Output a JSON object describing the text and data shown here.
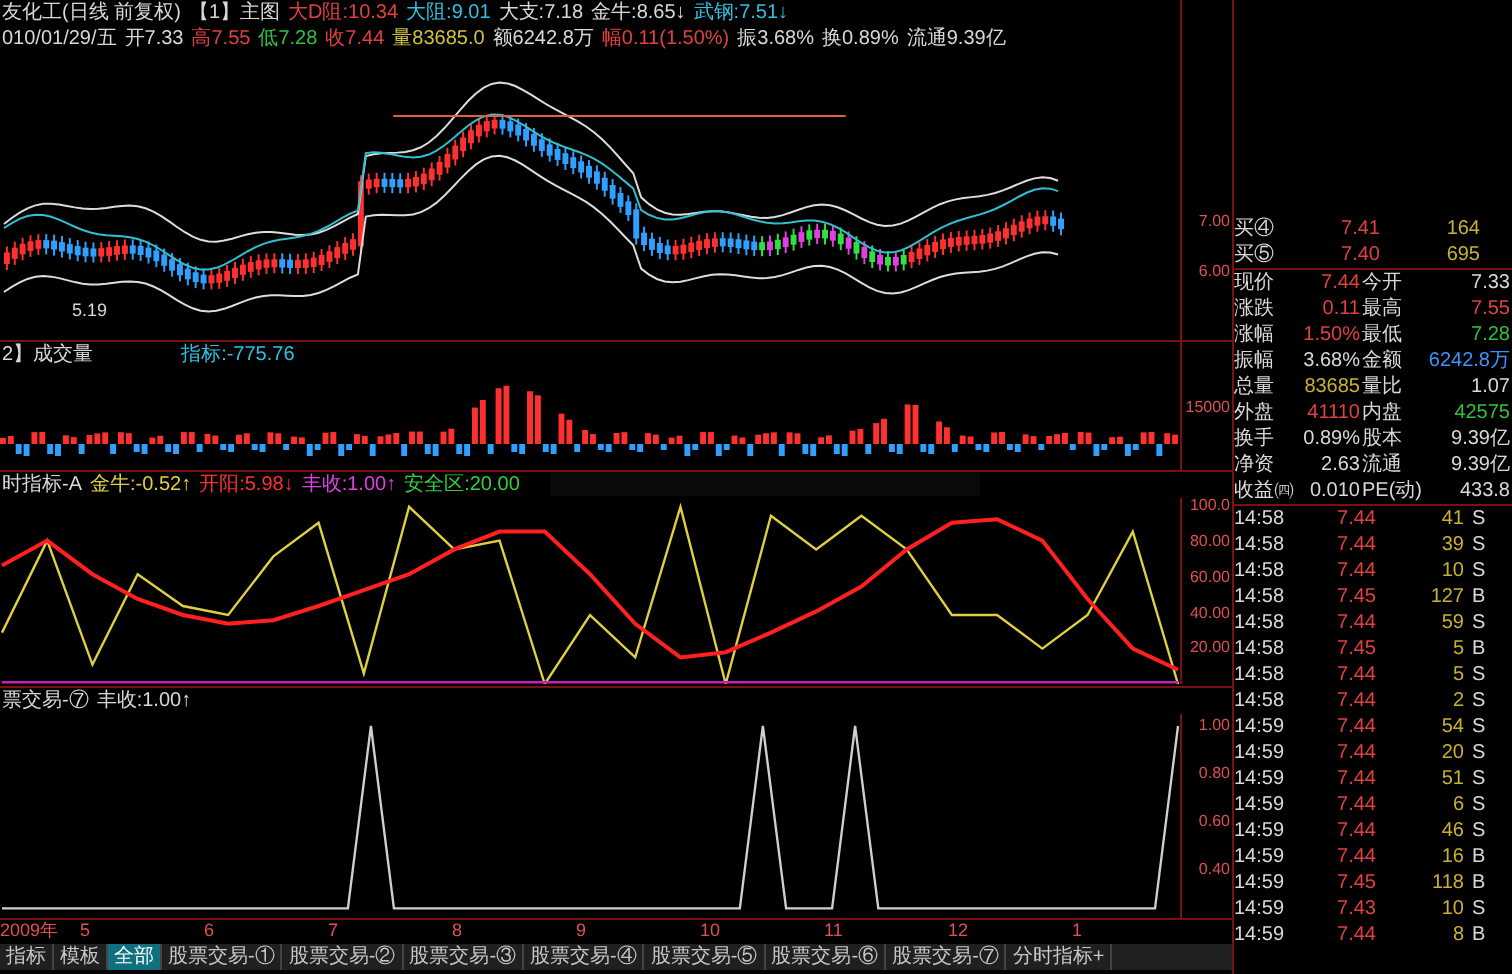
{
  "header": {
    "line1": [
      {
        "text": "友化工(日线 前复权)",
        "color": "#d8d8d8"
      },
      {
        "text": "【1】主图",
        "color": "#d8d8d8"
      },
      {
        "text": "大D阻:10.34",
        "color": "#e04040"
      },
      {
        "text": "大阻:9.01",
        "color": "#30c0e0"
      },
      {
        "text": "大支:7.18",
        "color": "#d8d8d8"
      },
      {
        "text": "金牛:8.65↓",
        "color": "#d8d8d8"
      },
      {
        "text": "武钢:7.51↓",
        "color": "#30c0e0"
      }
    ],
    "line2": [
      {
        "text": "010/01/29/五",
        "color": "#d8d8d8"
      },
      {
        "text": "开7.33",
        "color": "#d8d8d8"
      },
      {
        "text": "高7.55",
        "color": "#e04040"
      },
      {
        "text": "低7.28",
        "color": "#30c040"
      },
      {
        "text": "收7.44",
        "color": "#e04040"
      },
      {
        "text": "量83685.0",
        "color": "#d0c040"
      },
      {
        "text": "额6242.8万",
        "color": "#d8d8d8"
      },
      {
        "text": "幅0.11(1.50%)",
        "color": "#e04040"
      },
      {
        "text": "振3.68%",
        "color": "#d8d8d8"
      },
      {
        "text": "换0.89%",
        "color": "#d8d8d8"
      },
      {
        "text": "流通9.39亿",
        "color": "#d8d8d8"
      }
    ]
  },
  "price_chart": {
    "low_marker": "5.19",
    "axis": [
      "7.00",
      "6.00"
    ]
  },
  "volume_panel": {
    "title": "2】成交量",
    "indicator": "指标:-775.76",
    "axis": [
      "15000"
    ]
  },
  "indicator_panel": {
    "items": [
      {
        "text": "时指标-A",
        "color": "#d8d8d8"
      },
      {
        "text": "金牛:-0.52↑",
        "color": "#e0d040"
      },
      {
        "text": "开阳:5.98↓",
        "color": "#ff3030"
      },
      {
        "text": "丰收:1.00↑",
        "color": "#e040e0"
      },
      {
        "text": "安全区:20.00",
        "color": "#30d040"
      }
    ],
    "chart_data": {
      "type": "line",
      "ylim": [
        0,
        105
      ],
      "yticks": [
        {
          "value": 100,
          "label": "100.0"
        },
        {
          "value": 80,
          "label": "80.00"
        },
        {
          "value": 60,
          "label": "60.00"
        },
        {
          "value": 40,
          "label": "40.00"
        },
        {
          "value": 20,
          "label": "20.00"
        }
      ],
      "series": [
        {
          "color": "#e0d040",
          "values": [
            29,
            81,
            11,
            62,
            44,
            39,
            72,
            91,
            6,
            100,
            76,
            81,
            0,
            39,
            15,
            100,
            0,
            95,
            76,
            95,
            76,
            39,
            39,
            20,
            39,
            86,
            0
          ]
        },
        {
          "color": "#ff2020",
          "values": [
            67,
            81,
            62,
            48,
            39,
            34,
            36,
            44,
            53,
            62,
            76,
            86,
            86,
            62,
            34,
            15,
            18,
            29,
            41,
            55,
            76,
            91,
            93,
            81,
            48,
            20,
            8
          ]
        },
        {
          "color": "#c020c0",
          "values": [
            1,
            1,
            1,
            1,
            1,
            1,
            1,
            1,
            1,
            1,
            1,
            1,
            1,
            1,
            1,
            1,
            1,
            1,
            1,
            1,
            1,
            1,
            1,
            1,
            1,
            1,
            1
          ]
        }
      ]
    }
  },
  "lower_panel": {
    "items": [
      {
        "text": "票交易-⑦",
        "color": "#d8d8d8"
      },
      {
        "text": "丰收:1.00↑",
        "color": "#d8d8d8"
      }
    ],
    "chart_data": {
      "type": "line",
      "ylim": [
        0.2,
        1.05
      ],
      "yticks": [
        {
          "value": 1,
          "label": "1.00"
        },
        {
          "value": 0.8,
          "label": "0.80"
        },
        {
          "value": 0.6,
          "label": "0.60"
        },
        {
          "value": 0.4,
          "label": "0.40"
        }
      ],
      "series": [
        {
          "color": "#d0d0d0",
          "values": [
            0.24,
            0.24,
            0.24,
            0.24,
            0.24,
            0.24,
            0.24,
            0.24,
            0.24,
            0.24,
            0.24,
            0.24,
            0.24,
            0.24,
            0.24,
            0.24,
            1,
            0.24,
            0.24,
            0.24,
            0.24,
            0.24,
            0.24,
            0.24,
            0.24,
            0.24,
            0.24,
            0.24,
            0.24,
            0.24,
            0.24,
            0.24,
            0.24,
            1,
            0.24,
            0.24,
            0.24,
            1,
            0.24,
            0.24,
            0.24,
            0.24,
            0.24,
            0.24,
            0.24,
            0.24,
            0.24,
            0.24,
            0.24,
            0.24,
            0.24,
            1
          ]
        }
      ]
    }
  },
  "x_axis": [
    "2009年",
    "5",
    "6",
    "7",
    "8",
    "9",
    "10",
    "11",
    "12",
    "1"
  ],
  "bottom_tabs": [
    {
      "label": "指标",
      "selected": false
    },
    {
      "label": "模板",
      "selected": false
    },
    {
      "label": "全部",
      "selected": true
    },
    {
      "label": "股票交易-①",
      "selected": false
    },
    {
      "label": "股票交易-②",
      "selected": false
    },
    {
      "label": "股票交易-③",
      "selected": false
    },
    {
      "label": "股票交易-④",
      "selected": false
    },
    {
      "label": "股票交易-⑤",
      "selected": false
    },
    {
      "label": "股票交易-⑥",
      "selected": false
    },
    {
      "label": "股票交易-⑦",
      "selected": false
    },
    {
      "label": "分时指标+",
      "selected": false
    }
  ],
  "order_book": [
    {
      "label": "买④",
      "price": "7.41",
      "volume": "164"
    },
    {
      "label": "买⑤",
      "price": "7.40",
      "volume": "695"
    }
  ],
  "quote": [
    {
      "label1": "现价",
      "value1": {
        "text": "7.44",
        "color": "#e04040"
      },
      "label2": "今开",
      "value2": {
        "text": "7.33",
        "color": "#d8d8d8"
      }
    },
    {
      "label1": "涨跌",
      "value1": {
        "text": "0.11",
        "color": "#e04040"
      },
      "label2": "最高",
      "value2": {
        "text": "7.55",
        "color": "#e04040"
      }
    },
    {
      "label1": "涨幅",
      "value1": {
        "text": "1.50%",
        "color": "#e04040"
      },
      "label2": "最低",
      "value2": {
        "text": "7.28",
        "color": "#30c040"
      }
    },
    {
      "label1": "振幅",
      "value1": {
        "text": "3.68%",
        "color": "#d8d8d8"
      },
      "label2": "金额",
      "value2": {
        "text": "6242.8万",
        "color": "#4090ff"
      }
    },
    {
      "label1": "总量",
      "value1": {
        "text": "83685",
        "color": "#c8b030"
      },
      "label2": "量比",
      "value2": {
        "text": "1.07",
        "color": "#d8d8d8"
      }
    },
    {
      "label1": "外盘",
      "value1": {
        "text": "41110",
        "color": "#e04040"
      },
      "label2": "内盘",
      "value2": {
        "text": "42575",
        "color": "#30c040"
      }
    },
    {
      "label1": "换手",
      "value1": {
        "text": "0.89%",
        "color": "#d8d8d8"
      },
      "label2": "股本",
      "value2": {
        "text": "9.39亿",
        "color": "#d8d8d8"
      }
    },
    {
      "label1": "净资",
      "value1": {
        "text": "2.63",
        "color": "#d8d8d8"
      },
      "label2": "流通",
      "value2": {
        "text": "9.39亿",
        "color": "#d8d8d8"
      }
    },
    {
      "label1": "收益㈣",
      "value1": {
        "text": "0.010",
        "color": "#d8d8d8"
      },
      "label2": "PE(动)",
      "value2": {
        "text": "433.8",
        "color": "#d8d8d8"
      }
    }
  ],
  "ticks": [
    {
      "time": "14:58",
      "price": "7.44",
      "volume": "41",
      "side": "S"
    },
    {
      "time": "14:58",
      "price": "7.44",
      "volume": "39",
      "side": "S"
    },
    {
      "time": "14:58",
      "price": "7.44",
      "volume": "10",
      "side": "S"
    },
    {
      "time": "14:58",
      "price": "7.45",
      "volume": "127",
      "side": "B"
    },
    {
      "time": "14:58",
      "price": "7.44",
      "volume": "59",
      "side": "S"
    },
    {
      "time": "14:58",
      "price": "7.45",
      "volume": "5",
      "side": "B"
    },
    {
      "time": "14:58",
      "price": "7.44",
      "volume": "5",
      "side": "S"
    },
    {
      "time": "14:58",
      "price": "7.44",
      "volume": "2",
      "side": "S"
    },
    {
      "time": "14:59",
      "price": "7.44",
      "volume": "54",
      "side": "S"
    },
    {
      "time": "14:59",
      "price": "7.44",
      "volume": "20",
      "side": "S"
    },
    {
      "time": "14:59",
      "price": "7.44",
      "volume": "51",
      "side": "S"
    },
    {
      "time": "14:59",
      "price": "7.44",
      "volume": "6",
      "side": "S"
    },
    {
      "time": "14:59",
      "price": "7.44",
      "volume": "46",
      "side": "S"
    },
    {
      "time": "14:59",
      "price": "7.44",
      "volume": "16",
      "side": "B"
    },
    {
      "time": "14:59",
      "price": "7.45",
      "volume": "118",
      "side": "B"
    },
    {
      "time": "14:59",
      "price": "7.43",
      "volume": "10",
      "side": "S"
    },
    {
      "time": "14:59",
      "price": "7.44",
      "volume": "8",
      "side": "B"
    }
  ]
}
